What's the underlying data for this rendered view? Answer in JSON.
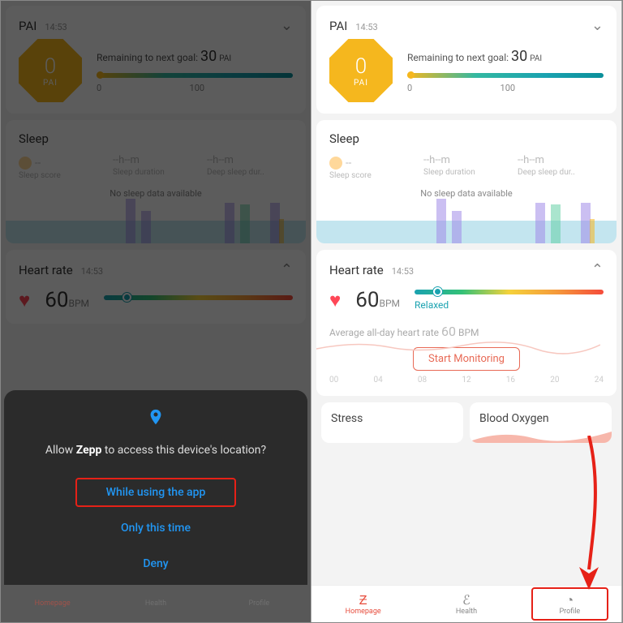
{
  "pai": {
    "title": "PAI",
    "time": "14:53",
    "value": "0",
    "valueLabel": "PAI",
    "remainText": "Remaining to next goal:",
    "remainValue": "30",
    "remainUnit": "PAI",
    "axis0": "0",
    "axis100": "100"
  },
  "sleep": {
    "title": "Sleep",
    "score": "--",
    "scoreLabel": "Sleep score",
    "duration": "--h--m",
    "durationLabel": "Sleep duration",
    "deep": "--h--m",
    "deepLabel": "Deep sleep dur..",
    "noData": "No sleep data available"
  },
  "hr": {
    "title": "Heart rate",
    "time": "14:53",
    "value": "60",
    "unit": "BPM",
    "status": "Relaxed",
    "avgText": "Average all-day heart rate",
    "avgValue": "60",
    "avgUnit": "BPM",
    "startBtn": "Start Monitoring",
    "axis": [
      "00",
      "04",
      "08",
      "12",
      "16",
      "20",
      "24"
    ]
  },
  "mini": {
    "stress": "Stress",
    "oxygen": "Blood Oxygen"
  },
  "nav": {
    "homepage": "Homepage",
    "health": "Health",
    "profile": "Profile"
  },
  "perm": {
    "prefix": "Allow ",
    "app": "Zepp",
    "suffix": " to access this device's location?",
    "whileUsing": "While using the app",
    "onlyOnce": "Only this time",
    "deny": "Deny"
  }
}
